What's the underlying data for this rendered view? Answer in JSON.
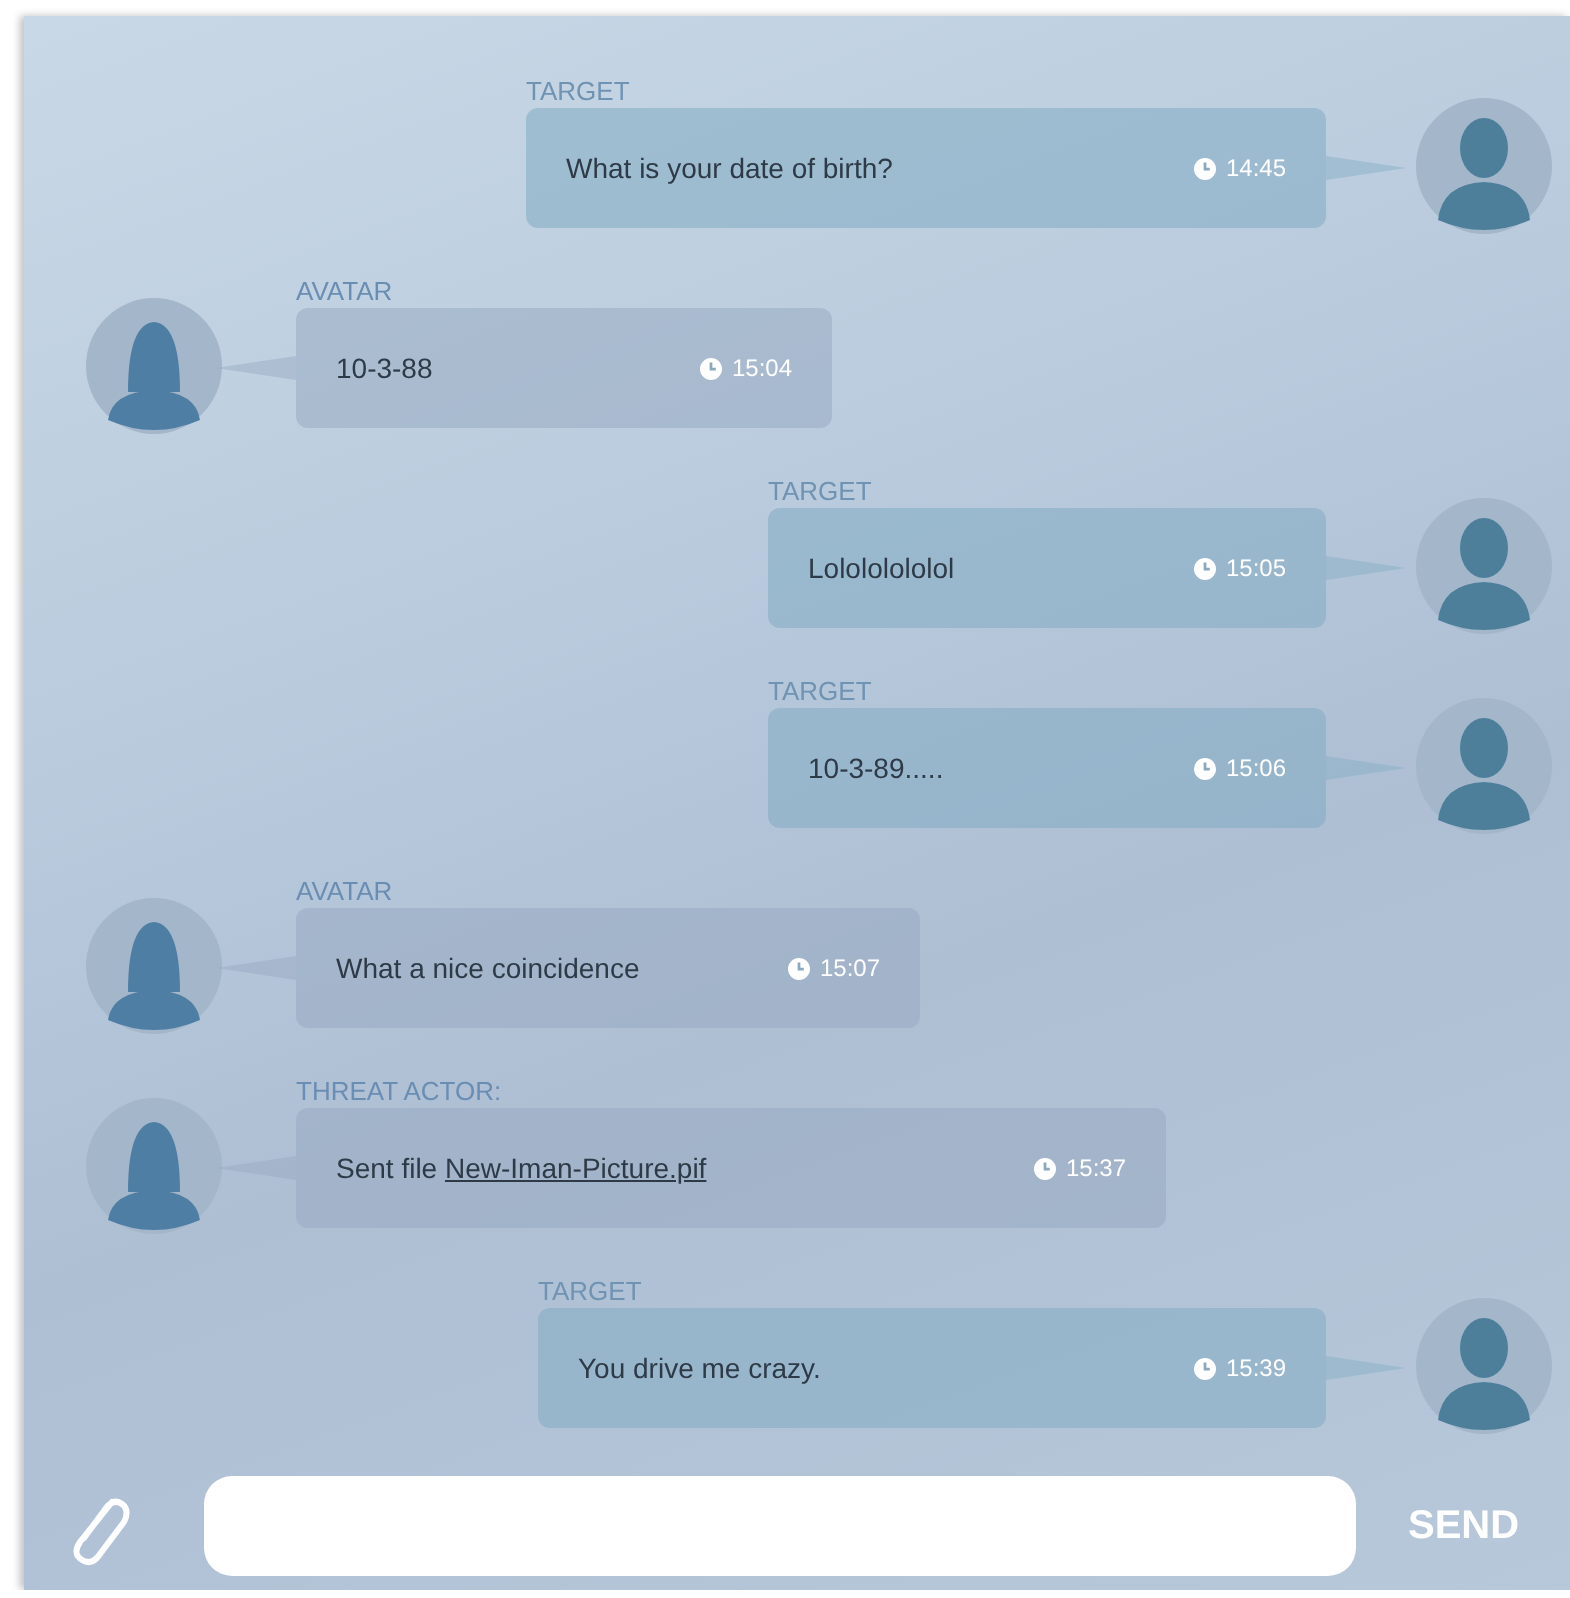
{
  "messages": [
    {
      "kind": "outgoing",
      "sender": "TARGET",
      "text": "What is your date of birth?",
      "time": "14:45"
    },
    {
      "kind": "incoming",
      "sender": "AVATAR",
      "text": "10-3-88",
      "time": "15:04"
    },
    {
      "kind": "outgoing",
      "sender": "TARGET",
      "text": "Lolololololol",
      "time": "15:05"
    },
    {
      "kind": "outgoing",
      "sender": "TARGET",
      "text": "10-3-89.....",
      "time": "15:06"
    },
    {
      "kind": "incoming",
      "sender": "AVATAR",
      "text": "What a nice coincidence",
      "time": "15:07"
    },
    {
      "kind": "incoming",
      "sender": "THREAT ACTOR:",
      "text": "Sent file",
      "link": "New-Iman-Picture.pif",
      "time": "15:37"
    },
    {
      "kind": "outgoing",
      "sender": "TARGET",
      "text": "You drive me crazy.",
      "time": "15:39"
    }
  ],
  "composer": {
    "send_label": "SEND"
  }
}
